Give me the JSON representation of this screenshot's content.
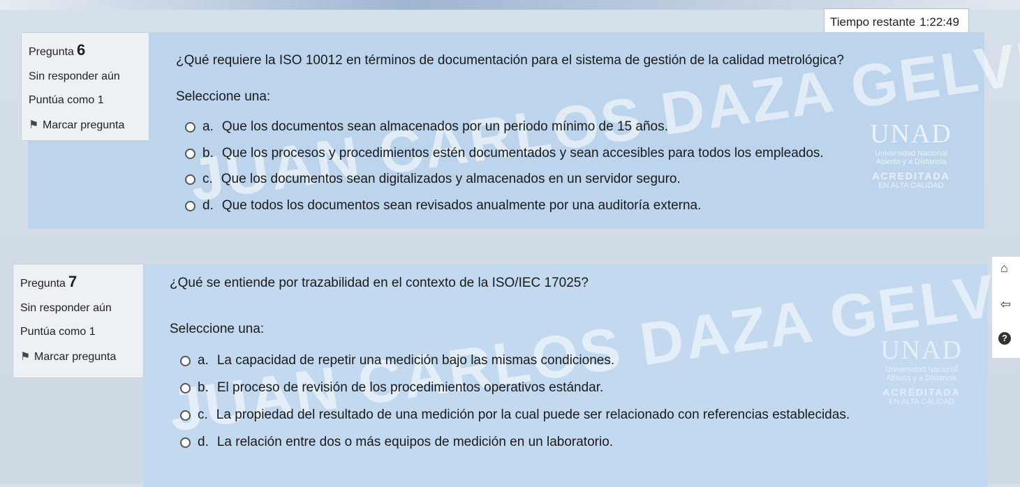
{
  "timer": {
    "label": "Tiempo restante",
    "value": "1:22:49"
  },
  "questions": [
    {
      "number_prefix": "Pregunta",
      "number": "6",
      "status": "Sin responder aún",
      "score": "Puntúa como 1",
      "flag_label": "Marcar pregunta",
      "text": "¿Qué requiere la ISO 10012 en términos de documentación para el sistema de gestión de la calidad metrológica?",
      "select_label": "Seleccione una:",
      "options": [
        {
          "letter": "a.",
          "text": "Que los documentos sean almacenados por un periodo mínimo de 15 años."
        },
        {
          "letter": "b.",
          "text": "Que los procesos y procedimientos estén documentados y sean accesibles para todos los empleados."
        },
        {
          "letter": "c.",
          "text": "Que los documentos sean digitalizados y almacenados en un servidor seguro."
        },
        {
          "letter": "d.",
          "text": "Que todos los documentos sean revisados anualmente por una auditoría externa."
        }
      ]
    },
    {
      "number_prefix": "Pregunta",
      "number": "7",
      "status": "Sin responder aún",
      "score": "Puntúa como 1",
      "flag_label": "Marcar pregunta",
      "text": "¿Qué se entiende por trazabilidad en el contexto de la ISO/IEC 17025?",
      "select_label": "Seleccione una:",
      "options": [
        {
          "letter": "a.",
          "text": "La capacidad de repetir una medición bajo las mismas condiciones."
        },
        {
          "letter": "b.",
          "text": "El proceso de revisión de los procedimientos operativos estándar."
        },
        {
          "letter": "c.",
          "text": "La propiedad del resultado de una medición por la cual puede ser relacionado con referencias establecidas."
        },
        {
          "letter": "d.",
          "text": "La relación entre dos o más equipos de medición en un laboratorio."
        }
      ]
    }
  ],
  "watermark": {
    "name": "JUAN CARLOS DAZA GELVIS"
  },
  "logo": {
    "brand": "UNAD",
    "line1": "Universidad Nacional",
    "line2": "Abierta y a Distancia",
    "acreditada": "ACREDITADA",
    "calidad": "EN ALTA CALIDAD"
  },
  "side_icons": [
    "home-icon",
    "back-arrow-icon",
    "help-icon"
  ]
}
